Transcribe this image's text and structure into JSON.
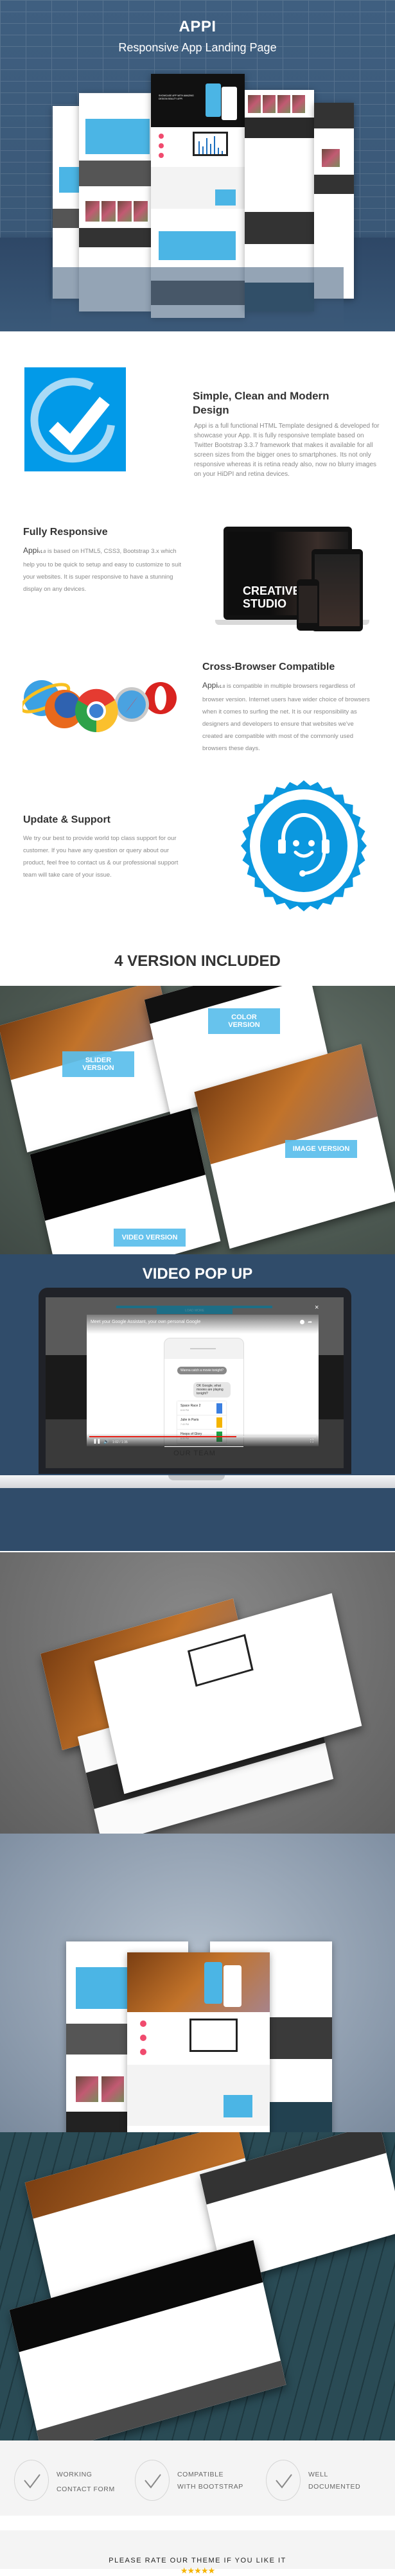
{
  "hero": {
    "title": "APPI",
    "subtitle": "Responsive App Landing Page",
    "mockup_headline": "SHOWCASE APP WITH AMAZING DESIGN BEAUTY APPI"
  },
  "features": [
    {
      "title": "Simple, Clean and Modern Design",
      "text": "Appi is a full functional HTML Template designed & developed for showcase your App. It is fully responsive template based on Twitter Bootstrap 3.3.7 framework that makes it available for all screen sizes from the bigger ones to smartphones. Its not only responsive whereas it is retina ready also, now no blurry images on your HiDPI and retina devices.",
      "icon": "check-circle-icon"
    },
    {
      "title": "Fully Responsive",
      "brand": "Appi",
      "version": "v1.0",
      "text": " is based on HTML5, CSS3, Bootstrap 3.x which help you to be quick to setup and easy to customize to suit your websites. It is super responsive to have a stunning display on any devices.",
      "icon": "devices-icon",
      "device_text_1": "CREATIVE",
      "device_text_2": "STUDIO"
    },
    {
      "title": "Cross-Browser Compatible",
      "brand": "Appi",
      "version": "v1.0",
      "text": " is compatible in multiple browsers regardless of browser version. Internet users have wider choice of browsers when it comes to surfing the net. It is our responsibility as designers and developers to ensure that websites we've created are compatible with most of the commonly used browsers these days.",
      "icon": "browsers-icon"
    },
    {
      "title": "Update & Support",
      "text": "We try our best to provide world top class support for our customer. If you have any question or query about our product, feel free to contact us & our professional support team will take care of your issue.",
      "icon": "support-headset-icon"
    }
  ],
  "versions": {
    "heading": "4 VERSION INCLUDED",
    "labels": [
      "SLIDER VERSION",
      "COLOR VERSION",
      "IMAGE VERSION",
      "VIDEO VERSION"
    ]
  },
  "video": {
    "heading": "VIDEO POP UP",
    "caption": "Meet your Google Assistant, your own personal Google",
    "close": "×",
    "chat_in": "Wanna catch a movie tonight?",
    "chat_out": "OK Google, what movies are playing tonight?",
    "movies": [
      {
        "title": "Space Race 2",
        "time": "8:00 PM",
        "color": "#3b7fe0"
      },
      {
        "title": "Julie in Paris",
        "time": "7:40 PM",
        "color": "#f4b400"
      },
      {
        "title": "Hoops of Glory",
        "time": "8:30 PM",
        "color": "#1ea446"
      }
    ],
    "time": "1:02 / 1:35",
    "progress": 0.65,
    "under_text": "OUR TEAM",
    "load_more": "LOAD MORE"
  },
  "checklist": [
    {
      "line1": "WORKING",
      "line2": "CONTACT FORM"
    },
    {
      "line1": "COMPATIBLE",
      "line2": "WITH BOOTSTRAP"
    },
    {
      "line1": "WELL",
      "line2": "DOCUMENTED"
    }
  ],
  "rating": {
    "text": "PLEASE RATE OUR THEME IF YOU LIKE IT",
    "stars": 5
  },
  "colors": {
    "hero_bg": "#3f5f80",
    "accent_blue": "#029ae8",
    "accent_pink": "#f04b6e",
    "video_bg": "#304c6a"
  }
}
